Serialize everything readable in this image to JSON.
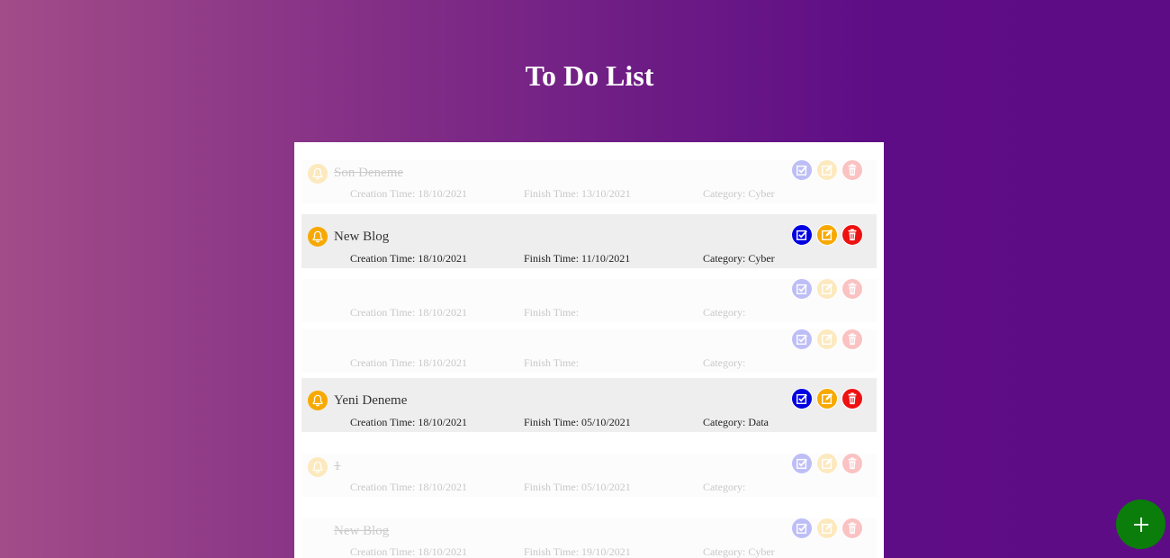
{
  "header": {
    "title": "To Do List"
  },
  "labels": {
    "creation": "Creation Time:",
    "finish": "Finish Time:",
    "category": "Category:"
  },
  "tasks": [
    {
      "title": "Son Deneme",
      "creation": "Creation Time: 18/10/2021",
      "finish": "Finish Time: 13/10/2021",
      "category": "Category: Cyber",
      "state": "faded",
      "strike": true,
      "bell": true
    },
    {
      "title": "New Blog",
      "creation": "Creation Time: 18/10/2021",
      "finish": "Finish Time: 11/10/2021",
      "category": "Category: Cyber",
      "state": "active",
      "strike": false,
      "bell": true
    },
    {
      "title": "",
      "creation": "Creation Time: 18/10/2021",
      "finish": "Finish Time:",
      "category": "Category:",
      "state": "faded",
      "strike": false,
      "bell": false
    },
    {
      "title": "",
      "creation": "Creation Time: 18/10/2021",
      "finish": "Finish Time:",
      "category": "Category:",
      "state": "faded",
      "strike": false,
      "bell": false
    },
    {
      "title": "Yeni Deneme",
      "creation": "Creation Time: 18/10/2021",
      "finish": "Finish Time: 05/10/2021",
      "category": "Category: Data",
      "state": "active",
      "strike": false,
      "bell": true
    },
    {
      "title": "1",
      "creation": "Creation Time: 18/10/2021",
      "finish": "Finish Time: 05/10/2021",
      "category": "Category:",
      "state": "faded",
      "strike": true,
      "bell": true
    },
    {
      "title": "New Blog",
      "creation": "Creation Time: 18/10/2021",
      "finish": "Finish Time: 19/10/2021",
      "category": "Category: Cyber",
      "state": "faded",
      "strike": true,
      "bell": false
    }
  ],
  "icons": {
    "bell": "bell-icon",
    "check": "check-icon",
    "edit": "edit-icon",
    "delete": "trash-icon",
    "add": "plus-icon"
  },
  "colors": {
    "bell": "#f7a900",
    "check": "#0000e0",
    "edit": "#f7a900",
    "delete": "#ee1111",
    "fab": "#0a7d0a"
  }
}
